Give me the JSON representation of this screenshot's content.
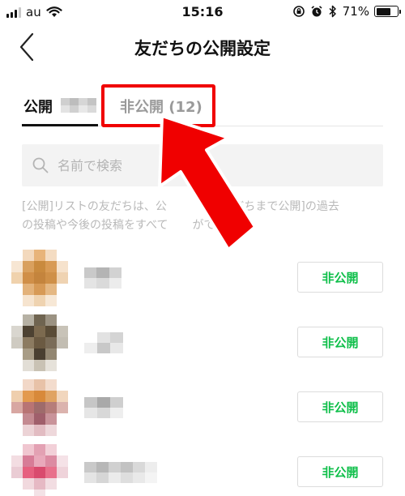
{
  "status_bar": {
    "carrier": "au",
    "time": "15:16",
    "battery": "71%",
    "battery_level": 0.71,
    "icons": [
      "signal-icon",
      "wifi-icon",
      "screen-rotation-lock-icon",
      "alarm-icon",
      "bluetooth-icon",
      "battery-icon"
    ]
  },
  "header": {
    "title": "友だちの公開設定",
    "back_icon": "back-chevron-icon"
  },
  "tabs": {
    "public_label": "公開",
    "private_label": "非公開 (12)",
    "active": "public"
  },
  "search": {
    "placeholder": "名前で検索",
    "value": "",
    "icon": "search-icon"
  },
  "description": {
    "line1": "[公開]リストの友だちは、公",
    "line1_end": "が[友だちまで公開]の過去",
    "line2": "の投稿や今後の投稿をすべて",
    "line2_end": "ができます。"
  },
  "friends": [
    {
      "button_label": "非公開",
      "avatar": "blurred-avatar",
      "name": "blurred-name"
    },
    {
      "button_label": "非公開",
      "avatar": "blurred-avatar",
      "name": "blurred-name"
    },
    {
      "button_label": "非公開",
      "avatar": "blurred-avatar",
      "name": "blurred-name"
    },
    {
      "button_label": "非公開",
      "avatar": "blurred-avatar",
      "name": "blurred-name"
    }
  ],
  "colors": {
    "accent_green": "#0fbf4a",
    "highlight_red": "#f00000",
    "inactive_tab": "#9a9a9a",
    "search_bg": "#f3f3f3"
  },
  "annotation": {
    "type": "red-arrow-and-box",
    "target": "tab-private"
  }
}
